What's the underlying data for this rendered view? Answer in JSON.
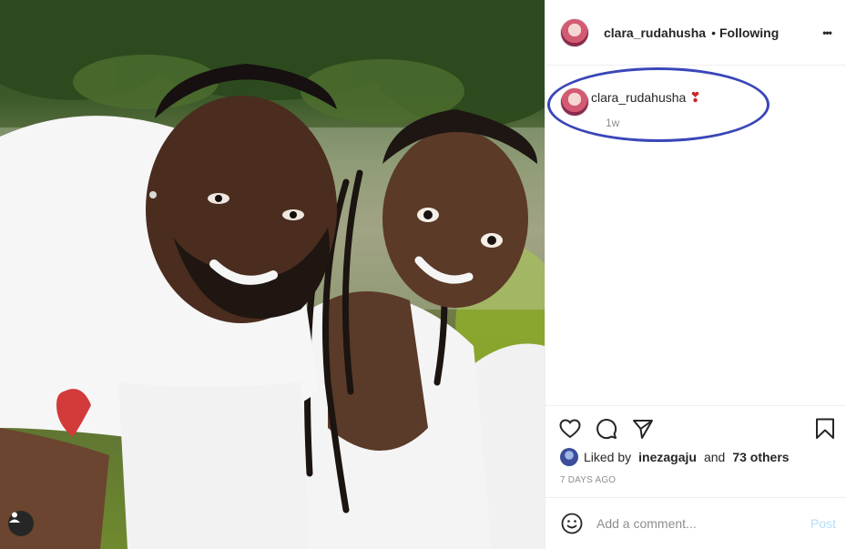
{
  "post": {
    "username": "clara_rudahusha",
    "dot": "•",
    "following_label": "Following",
    "more_label": "•••",
    "caption": {
      "username": "clara_rudahusha",
      "emoji": "❣",
      "time": "1w"
    },
    "likes": {
      "prefix": "Liked by",
      "user": "inezagaju",
      "and": "and",
      "others": "73 others"
    },
    "date": "7 DAYS AGO",
    "comment": {
      "placeholder": "Add a comment...",
      "post_label": "Post"
    }
  },
  "colors": {
    "annotation_ring": "#3a46b8",
    "post_disabled": "#b2dffc"
  }
}
